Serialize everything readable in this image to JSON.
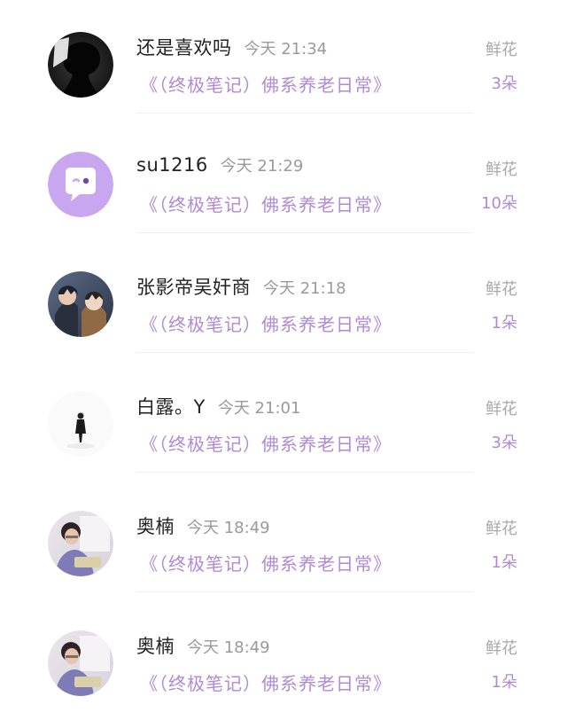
{
  "rows": [
    {
      "name": "还是喜欢吗",
      "time": "今天 21:34",
      "book": "《（终极笔记）佛系养老日常》",
      "gift_label": "鲜花",
      "gift_count": "3朵",
      "avatar": "dark-profile-avatar"
    },
    {
      "name": "su1216",
      "time": "今天 21:29",
      "book": "《（终极笔记）佛系养老日常》",
      "gift_label": "鲜花",
      "gift_count": "10朵",
      "avatar": "chat-bubble-avatar"
    },
    {
      "name": "张影帝吴奸商",
      "time": "今天 21:18",
      "book": "《（终极笔记）佛系养老日常》",
      "gift_label": "鲜花",
      "gift_count": "1朵",
      "avatar": "anime-characters-avatar"
    },
    {
      "name": "白露。Y",
      "time": "今天 21:01",
      "book": "《（终极笔记）佛系养老日常》",
      "gift_label": "鲜花",
      "gift_count": "3朵",
      "avatar": "silhouette-figure-avatar"
    },
    {
      "name": "奥楠",
      "time": "今天 18:49",
      "book": "《（终极笔记）佛系养老日常》",
      "gift_label": "鲜花",
      "gift_count": "1朵",
      "avatar": "person-photo-avatar"
    },
    {
      "name": "奥楠",
      "time": "今天 18:49",
      "book": "《（终极笔记）佛系养老日常》",
      "gift_label": "鲜花",
      "gift_count": "1朵",
      "avatar": "person-photo-avatar"
    }
  ],
  "colors": {
    "accent_purple": "#b08ad6",
    "avatar_purple": "#c9a7f0",
    "name_text": "#222222",
    "muted_text": "#9a9a9a"
  }
}
